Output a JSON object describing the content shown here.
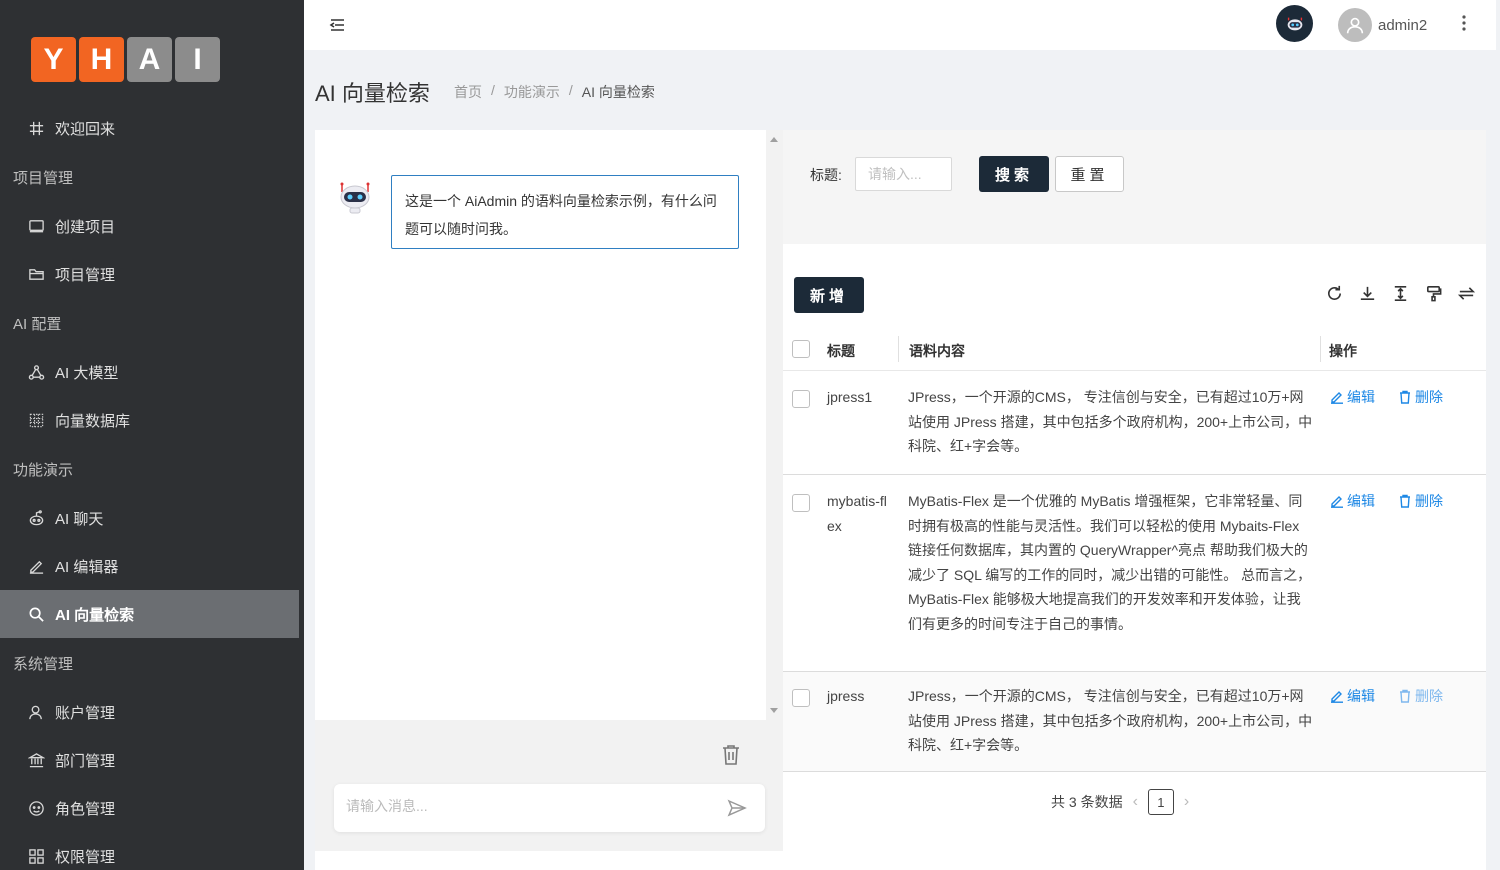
{
  "logo": {
    "letters": [
      "Y",
      "H",
      "A",
      "I"
    ]
  },
  "sidebar": {
    "welcome": "欢迎回来",
    "groups": [
      {
        "title": "项目管理",
        "items": [
          "创建项目",
          "项目管理"
        ]
      },
      {
        "title": "AI 配置",
        "items": [
          "AI 大模型",
          "向量数据库"
        ]
      },
      {
        "title": "功能演示",
        "items": [
          "AI 聊天",
          "AI 编辑器",
          "AI 向量检索"
        ]
      },
      {
        "title": "系统管理",
        "items": [
          "账户管理",
          "部门管理",
          "角色管理",
          "权限管理"
        ]
      }
    ],
    "active": "AI 向量检索"
  },
  "header": {
    "username": "admin2"
  },
  "page": {
    "title": "AI 向量检索",
    "breadcrumb": [
      "首页",
      "/",
      "功能演示",
      "/",
      "AI 向量检索"
    ]
  },
  "chat": {
    "welcome_message": "这是一个 AiAdmin 的语料向量检索示例，有什么问题可以随时问我。",
    "input_placeholder": "请输入消息..."
  },
  "search": {
    "label": "标题:",
    "placeholder": "请输入...",
    "search_button": "搜索",
    "reset_button": "重置"
  },
  "table": {
    "add_button": "新增",
    "columns": [
      "标题",
      "语料内容",
      "操作"
    ],
    "rows": [
      {
        "title": "jpress1",
        "content": "JPress，一个开源的CMS， 专注信创与安全，已有超过10万+网站使用 JPress 搭建，其中包括多个政府机构，200+上市公司，中科院、红+字会等。"
      },
      {
        "title": "mybatis-flex",
        "content": "MyBatis-Flex 是一个优雅的 MyBatis 增强框架，它非常轻量、同时拥有极高的性能与灵活性。我们可以轻松的使用 Mybaits-Flex 链接任何数据库，其内置的 QueryWrapper^亮点 帮助我们极大的减少了 SQL 编写的工作的同时，减少出错的可能性。 总而言之，MyBatis-Flex 能够极大地提高我们的开发效率和开发体验，让我们有更多的时间专注于自己的事情。"
      },
      {
        "title": "jpress",
        "content": "JPress，一个开源的CMS， 专注信创与安全，已有超过10万+网站使用 JPress 搭建，其中包括多个政府机构，200+上市公司，中科院、红+字会等。"
      }
    ],
    "edit_label": "编辑",
    "delete_label": "删除"
  },
  "pagination": {
    "total_text": "共 3 条数据",
    "current_page": "1"
  },
  "colors": {
    "sidebar_bg": "#2e3033",
    "primary_dark": "#1c2a38",
    "link_blue": "#1e88e5",
    "logo_orange": "#f26522",
    "logo_grey": "#8c8c8c"
  }
}
